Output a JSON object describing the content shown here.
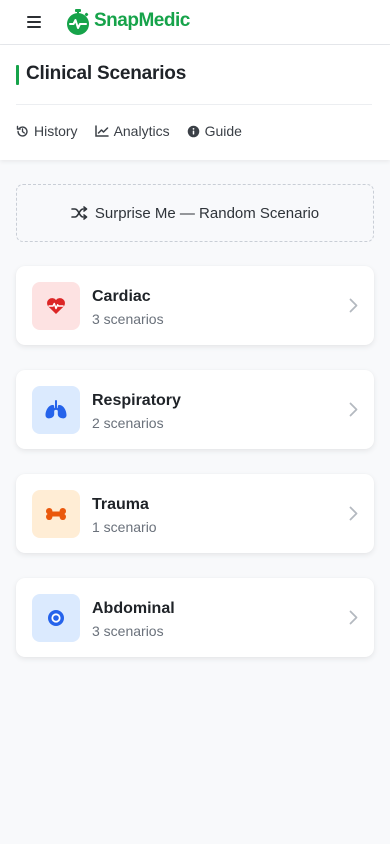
{
  "app": {
    "brand": "SnapMedic",
    "brand_color": "#16a34a"
  },
  "header": {
    "title": "Clinical Scenarios",
    "nav": [
      {
        "label": "History",
        "icon": "history-icon"
      },
      {
        "label": "Analytics",
        "icon": "analytics-icon"
      },
      {
        "label": "Guide",
        "icon": "info-icon"
      }
    ]
  },
  "random_button": {
    "label": "Surprise Me — Random Scenario",
    "icon": "shuffle-icon"
  },
  "categories": [
    {
      "name": "Cardiac",
      "count": "3 scenarios",
      "icon": "heart-pulse-icon",
      "bg": "#fde2e2",
      "color": "#dc2626"
    },
    {
      "name": "Respiratory",
      "count": "2 scenarios",
      "icon": "lungs-icon",
      "bg": "#dbeafe",
      "color": "#2563eb"
    },
    {
      "name": "Trauma",
      "count": "1 scenario",
      "icon": "bone-icon",
      "bg": "#ffedd5",
      "color": "#ea580c"
    },
    {
      "name": "Abdominal",
      "count": "3 scenarios",
      "icon": "target-icon",
      "bg": "#dbeafe",
      "color": "#2563eb"
    }
  ]
}
